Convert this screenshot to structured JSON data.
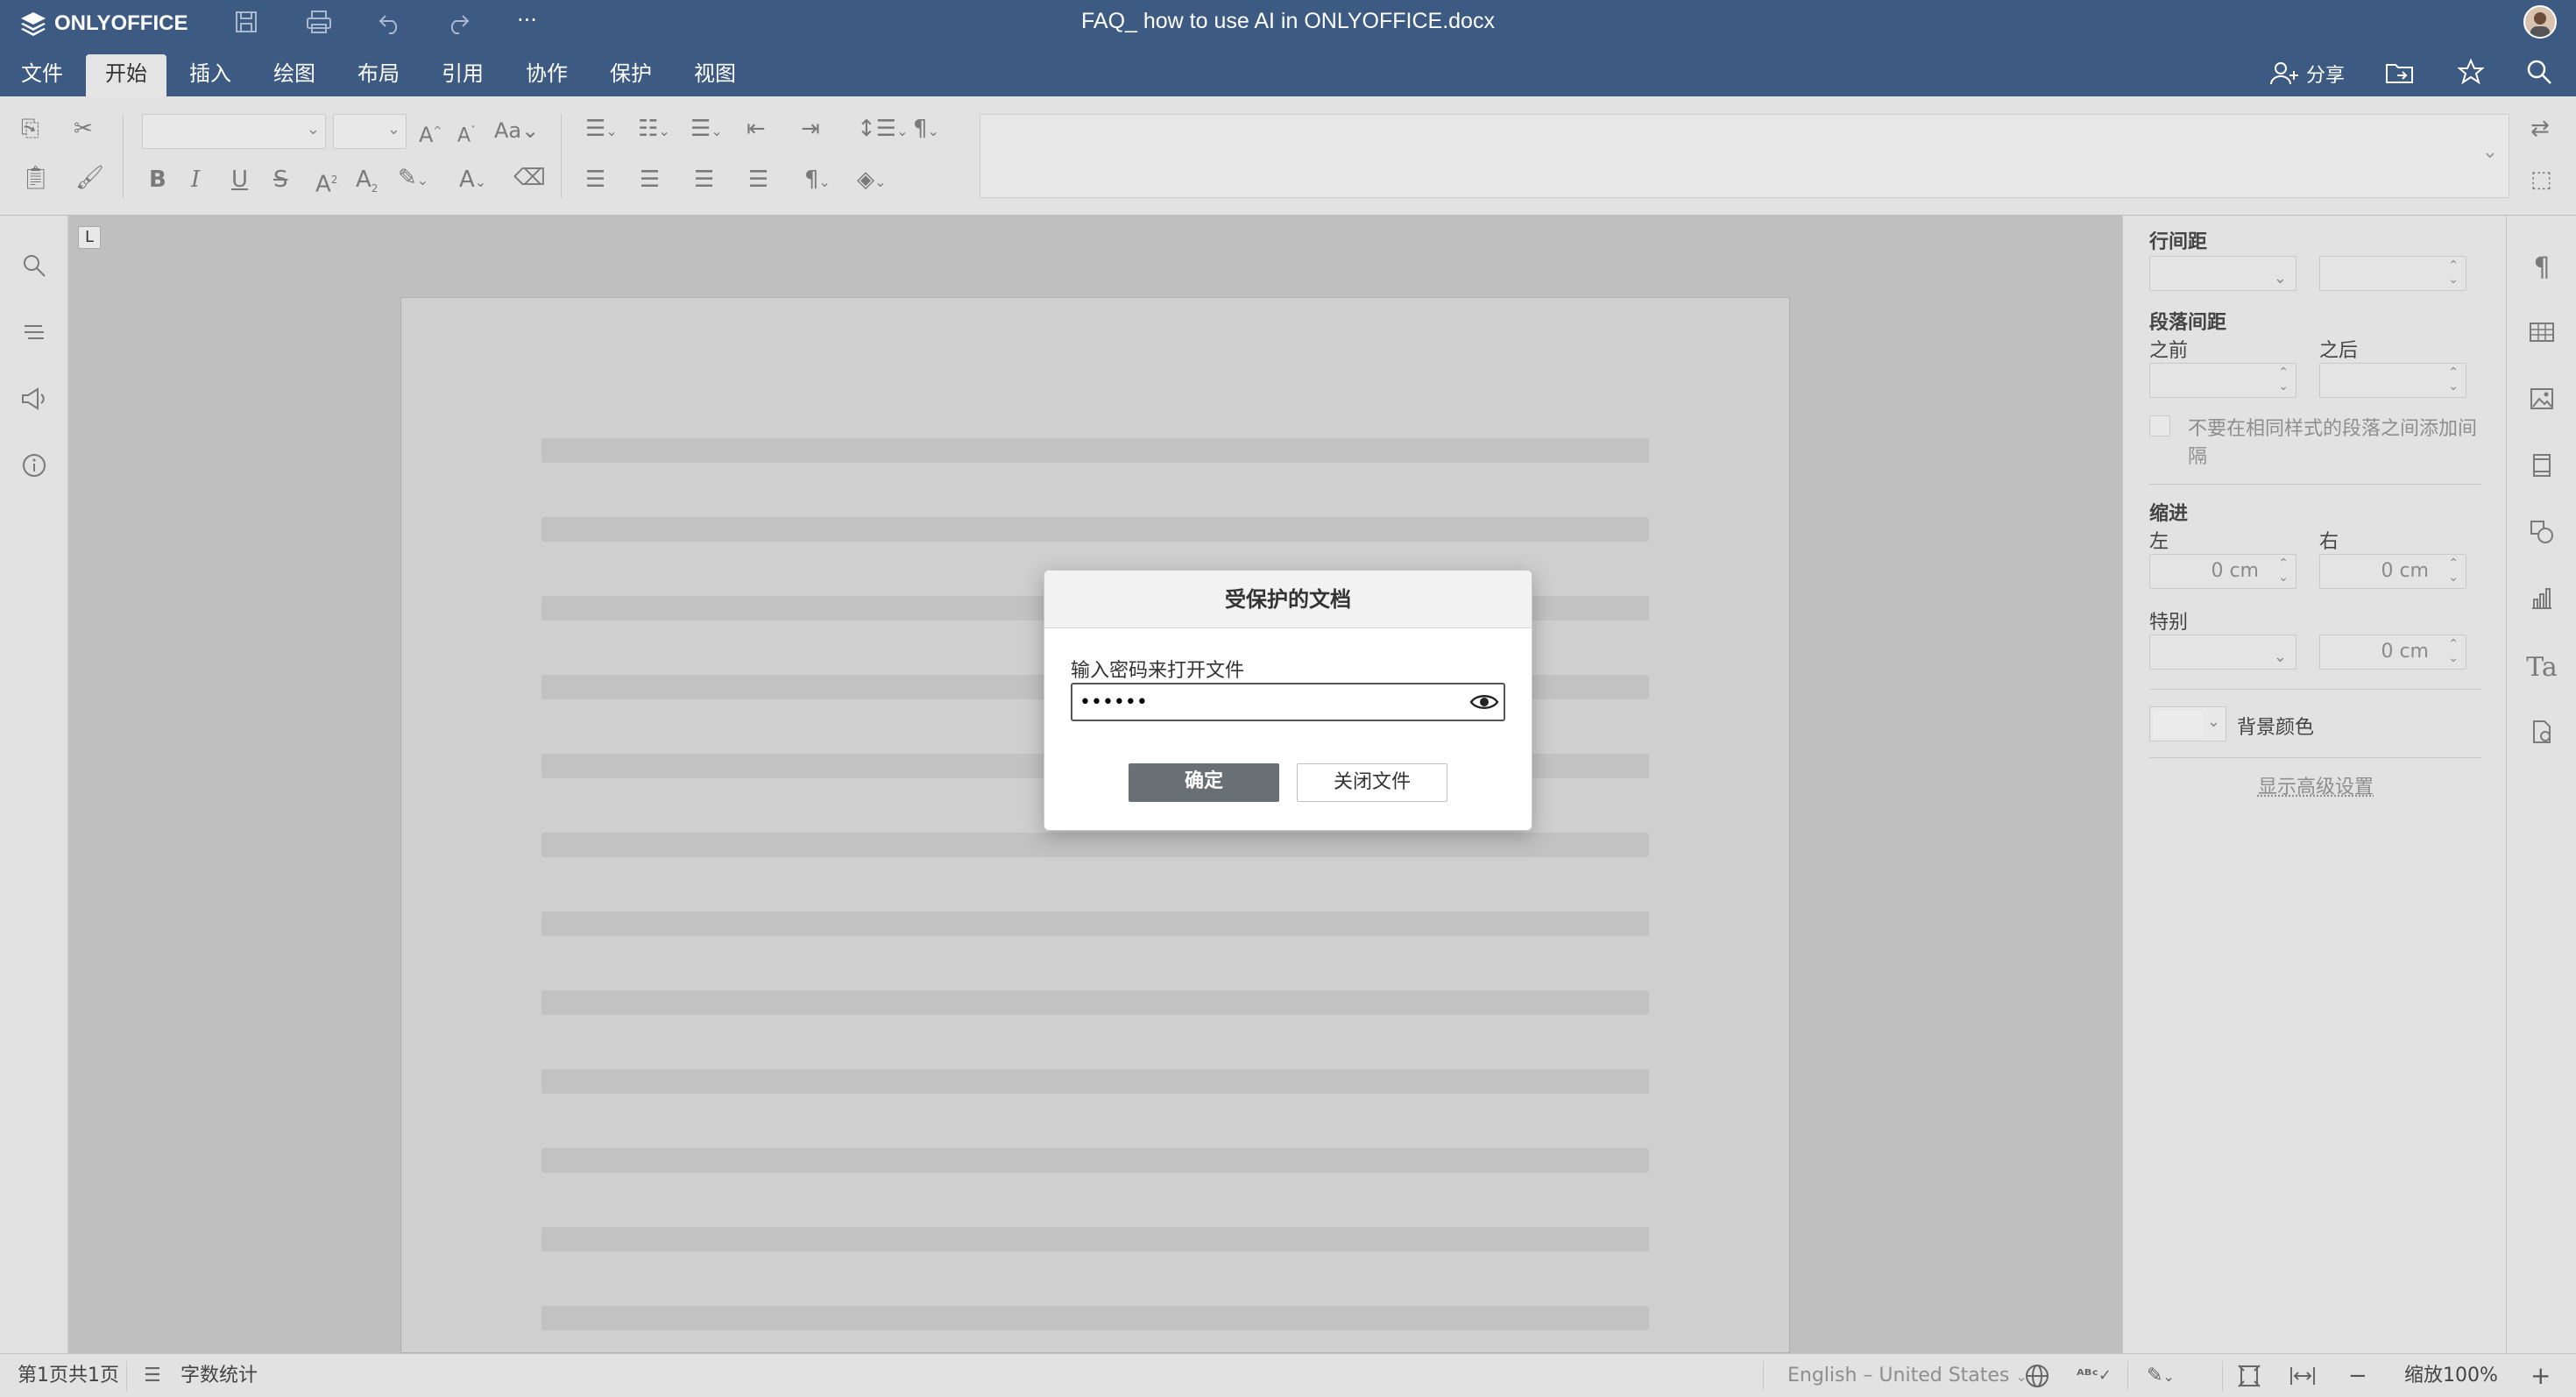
{
  "header": {
    "logo_text": "ONLYOFFICE",
    "doc_title": "FAQ_ how to use AI in ONLYOFFICE.docx",
    "more_label": "···",
    "share_label": "分享"
  },
  "menu": {
    "tabs": [
      "文件",
      "开始",
      "插入",
      "绘图",
      "布局",
      "引用",
      "协作",
      "保护",
      "视图"
    ],
    "active": "开始"
  },
  "right_panel": {
    "line_spacing": "行间距",
    "para_spacing": "段落间距",
    "before": "之前",
    "after": "之后",
    "no_space_checkbox": "不要在相同样式的段落之间添加间隔",
    "indent": "缩进",
    "left": "左",
    "right": "右",
    "left_value": "0 cm",
    "right_value": "0 cm",
    "special": "特别",
    "special_value": "0 cm",
    "bg_color": "背景颜色",
    "advanced": "显示高级设置"
  },
  "status": {
    "page_info": "第1页共1页",
    "word_count": "字数统计",
    "language": "English – United States",
    "zoom": "缩放100%"
  },
  "modal": {
    "title": "受保护的文档",
    "prompt": "输入密码来打开文件",
    "password_value": "••••••",
    "ok_label": "确定",
    "close_label": "关闭文件"
  },
  "colors": {
    "header_bg": "#3c5a82",
    "toolbar_bg": "#e2e2e2",
    "ok_button": "#686f75"
  }
}
